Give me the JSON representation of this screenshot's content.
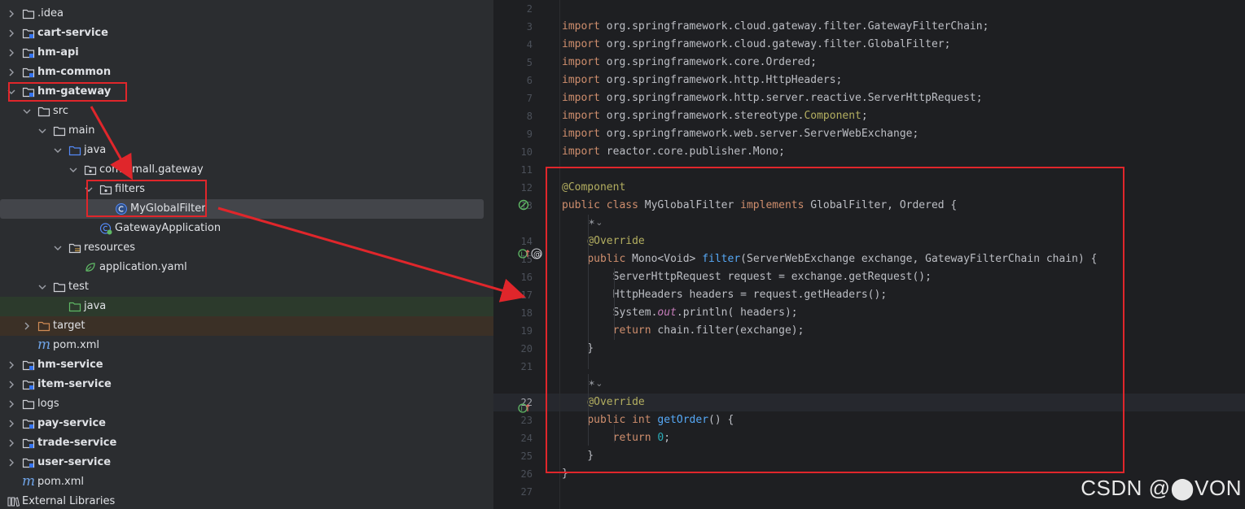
{
  "project_tree": [
    {
      "label": ".idea",
      "kind": "folder",
      "depth": 0,
      "expanded": false,
      "bold": false
    },
    {
      "label": "cart-service",
      "kind": "module",
      "depth": 0,
      "expanded": false,
      "bold": true
    },
    {
      "label": "hm-api",
      "kind": "module",
      "depth": 0,
      "expanded": false,
      "bold": true
    },
    {
      "label": "hm-common",
      "kind": "module",
      "depth": 0,
      "expanded": false,
      "bold": true
    },
    {
      "label": "hm-gateway",
      "kind": "module",
      "depth": 0,
      "expanded": true,
      "bold": true
    },
    {
      "label": "src",
      "kind": "folder",
      "depth": 1,
      "expanded": true,
      "bold": false
    },
    {
      "label": "main",
      "kind": "folder",
      "depth": 2,
      "expanded": true,
      "bold": false
    },
    {
      "label": "java",
      "kind": "source-folder",
      "depth": 3,
      "expanded": true,
      "bold": false
    },
    {
      "label": "com.hmall.gateway",
      "kind": "package",
      "depth": 4,
      "expanded": true,
      "bold": false
    },
    {
      "label": "filters",
      "kind": "package",
      "depth": 5,
      "expanded": true,
      "bold": false
    },
    {
      "label": "MyGlobalFilter",
      "kind": "class",
      "depth": 6,
      "expanded": null,
      "bold": false,
      "selected": true
    },
    {
      "label": "GatewayApplication",
      "kind": "spring-class",
      "depth": 5,
      "expanded": null,
      "bold": false
    },
    {
      "label": "resources",
      "kind": "resource-folder",
      "depth": 3,
      "expanded": true,
      "bold": false
    },
    {
      "label": "application.yaml",
      "kind": "yaml",
      "depth": 4,
      "expanded": null,
      "bold": false
    },
    {
      "label": "test",
      "kind": "folder",
      "depth": 2,
      "expanded": true,
      "bold": false
    },
    {
      "label": "java",
      "kind": "test-folder",
      "depth": 3,
      "expanded": null,
      "bold": false,
      "tint": "green"
    },
    {
      "label": "target",
      "kind": "excluded-folder",
      "depth": 1,
      "expanded": false,
      "bold": false,
      "tint": "orange"
    },
    {
      "label": "pom.xml",
      "kind": "maven",
      "depth": 1,
      "expanded": null,
      "bold": false
    },
    {
      "label": "hm-service",
      "kind": "module",
      "depth": 0,
      "expanded": false,
      "bold": true
    },
    {
      "label": "item-service",
      "kind": "module",
      "depth": 0,
      "expanded": false,
      "bold": true
    },
    {
      "label": "logs",
      "kind": "folder",
      "depth": 0,
      "expanded": false,
      "bold": false
    },
    {
      "label": "pay-service",
      "kind": "module",
      "depth": 0,
      "expanded": false,
      "bold": true
    },
    {
      "label": "trade-service",
      "kind": "module",
      "depth": 0,
      "expanded": false,
      "bold": true
    },
    {
      "label": "user-service",
      "kind": "module",
      "depth": 0,
      "expanded": false,
      "bold": true
    },
    {
      "label": "pom.xml",
      "kind": "maven",
      "depth": 0,
      "expanded": null,
      "bold": false
    },
    {
      "label": "External Libraries",
      "kind": "libraries",
      "depth": -1,
      "expanded": false,
      "bold": false
    }
  ],
  "editor": {
    "current_line": "22",
    "lines": [
      {
        "num": "2",
        "tokens": []
      },
      {
        "num": "3",
        "tokens": [
          {
            "t": "import ",
            "c": "kw"
          },
          {
            "t": "org.springframework.cloud.gateway.filter.GatewayFilterChain;",
            "c": "plain"
          }
        ]
      },
      {
        "num": "4",
        "tokens": [
          {
            "t": "import ",
            "c": "kw"
          },
          {
            "t": "org.springframework.cloud.gateway.filter.GlobalFilter;",
            "c": "plain"
          }
        ]
      },
      {
        "num": "5",
        "tokens": [
          {
            "t": "import ",
            "c": "kw"
          },
          {
            "t": "org.springframework.core.Ordered;",
            "c": "plain"
          }
        ]
      },
      {
        "num": "6",
        "tokens": [
          {
            "t": "import ",
            "c": "kw"
          },
          {
            "t": "org.springframework.http.HttpHeaders;",
            "c": "plain"
          }
        ]
      },
      {
        "num": "7",
        "tokens": [
          {
            "t": "import ",
            "c": "kw"
          },
          {
            "t": "org.springframework.http.server.reactive.ServerHttpRequest;",
            "c": "plain"
          }
        ]
      },
      {
        "num": "8",
        "tokens": [
          {
            "t": "import ",
            "c": "kw"
          },
          {
            "t": "org.springframework.stereotype.",
            "c": "plain"
          },
          {
            "t": "Component",
            "c": "ann"
          },
          {
            "t": ";",
            "c": "plain"
          }
        ]
      },
      {
        "num": "9",
        "tokens": [
          {
            "t": "import ",
            "c": "kw"
          },
          {
            "t": "org.springframework.web.server.ServerWebExchange;",
            "c": "plain"
          }
        ]
      },
      {
        "num": "10",
        "tokens": [
          {
            "t": "import ",
            "c": "kw"
          },
          {
            "t": "reactor.core.publisher.Mono;",
            "c": "plain"
          }
        ]
      },
      {
        "num": "11",
        "tokens": []
      },
      {
        "num": "12",
        "tokens": [
          {
            "t": "@Component",
            "c": "ann"
          }
        ]
      },
      {
        "num": "13",
        "tokens": [
          {
            "t": "public class ",
            "c": "kw"
          },
          {
            "t": "MyGlobalFilter ",
            "c": "plain"
          },
          {
            "t": "implements ",
            "c": "kw"
          },
          {
            "t": "GlobalFilter, Ordered {",
            "c": "plain"
          }
        ]
      },
      {
        "num": "",
        "hint": true
      },
      {
        "num": "14",
        "tokens": [
          {
            "t": "    ",
            "c": "plain"
          },
          {
            "t": "@Override",
            "c": "ann"
          }
        ]
      },
      {
        "num": "15",
        "tokens": [
          {
            "t": "    ",
            "c": "plain"
          },
          {
            "t": "public ",
            "c": "kw"
          },
          {
            "t": "Mono<Void> ",
            "c": "plain"
          },
          {
            "t": "filter",
            "c": "fn"
          },
          {
            "t": "(ServerWebExchange exchange, GatewayFilterChain chain) {",
            "c": "plain"
          }
        ]
      },
      {
        "num": "16",
        "tokens": [
          {
            "t": "        ServerHttpRequest request = exchange.getRequest();",
            "c": "plain"
          }
        ]
      },
      {
        "num": "17",
        "tokens": [
          {
            "t": "        HttpHeaders headers = request.getHeaders();",
            "c": "plain"
          }
        ]
      },
      {
        "num": "18",
        "tokens": [
          {
            "t": "        System.",
            "c": "plain"
          },
          {
            "t": "out",
            "c": "st"
          },
          {
            "t": ".println( headers);",
            "c": "plain"
          }
        ]
      },
      {
        "num": "19",
        "tokens": [
          {
            "t": "        ",
            "c": "plain"
          },
          {
            "t": "return ",
            "c": "kw"
          },
          {
            "t": "chain.filter(exchange);",
            "c": "plain"
          }
        ]
      },
      {
        "num": "20",
        "tokens": [
          {
            "t": "    }",
            "c": "plain"
          }
        ]
      },
      {
        "num": "21",
        "tokens": []
      },
      {
        "num": "",
        "hint": true
      },
      {
        "num": "22",
        "tokens": [
          {
            "t": "    ",
            "c": "plain"
          },
          {
            "t": "@Override",
            "c": "ann"
          }
        ]
      },
      {
        "num": "23",
        "tokens": [
          {
            "t": "    ",
            "c": "plain"
          },
          {
            "t": "public int ",
            "c": "kw"
          },
          {
            "t": "getOrder",
            "c": "fn"
          },
          {
            "t": "() {",
            "c": "plain"
          }
        ]
      },
      {
        "num": "24",
        "tokens": [
          {
            "t": "        ",
            "c": "plain"
          },
          {
            "t": "return ",
            "c": "kw"
          },
          {
            "t": "0",
            "c": "num"
          },
          {
            "t": ";",
            "c": "plain"
          }
        ]
      },
      {
        "num": "25",
        "tokens": [
          {
            "t": "    }",
            "c": "plain"
          }
        ]
      },
      {
        "num": "26",
        "tokens": [
          {
            "t": "}",
            "c": "plain"
          }
        ]
      },
      {
        "num": "27",
        "tokens": []
      }
    ]
  },
  "watermark": "CSDN @⬤VON",
  "colors": {
    "annotation_red": "#e0262b",
    "keyword": "#cf8e6d",
    "annotation": "#b3ae60",
    "function": "#56a8f5",
    "static_field": "#c77dbb",
    "number": "#2aacb8"
  }
}
